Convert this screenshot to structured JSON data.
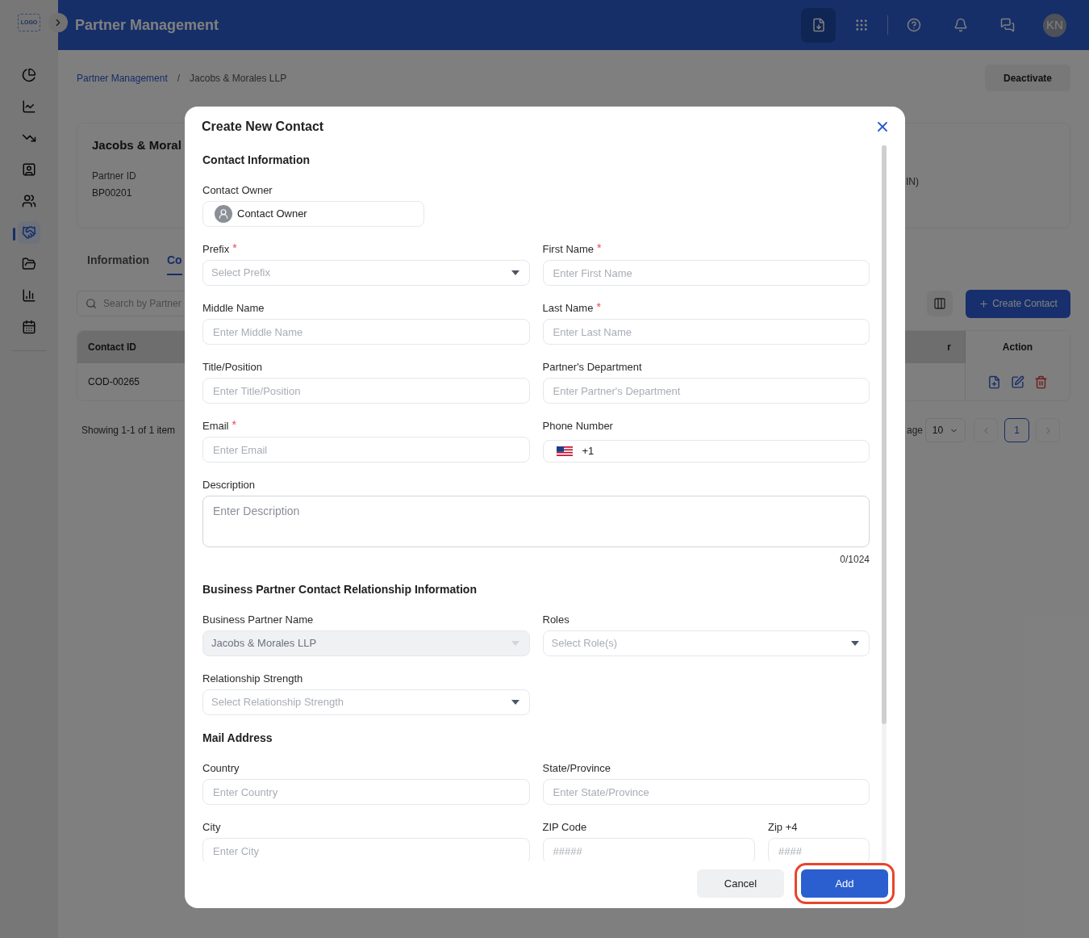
{
  "app": {
    "logo": "LOGO",
    "title": "Partner Management",
    "avatar": "KN"
  },
  "sidebar": {
    "items": [
      {
        "selected": false
      },
      {
        "selected": false
      },
      {
        "selected": false
      },
      {
        "selected": false
      },
      {
        "selected": false
      },
      {
        "selected": true
      },
      {
        "selected": false
      },
      {
        "selected": false
      },
      {
        "selected": false
      }
    ]
  },
  "breadcrumb": [
    "Partner Management",
    "Jacobs & Morales LLP"
  ],
  "breadcrumb_separator": "/",
  "deactivate_button": "Deactivate",
  "partner_card": {
    "name": "Jacobs & Moral",
    "id_label": "Partner ID",
    "id_value": "BP00201",
    "column_3": "IN)"
  },
  "tabs": [
    {
      "label": "Information",
      "selected": false
    },
    {
      "label": "Co",
      "selected": true
    }
  ],
  "search": {
    "placeholder": "Search by Partner"
  },
  "create_contact_button": "Create Contact",
  "table": {
    "columns": [
      "Contact ID",
      "r",
      "Action"
    ],
    "rows": [
      {
        "cells": [
          "COD-00265"
        ]
      }
    ]
  },
  "pagination": {
    "summary": "Showing 1-1 of 1 item",
    "per_page_label": "age",
    "per_page": "10",
    "pages": [
      {
        "label": "1",
        "selected": true
      }
    ]
  },
  "modal": {
    "title": "Create New Contact",
    "required_mark": "*",
    "sections": [
      {
        "title": "Contact Information",
        "rows": [
          [
            {
              "kind": "owner",
              "label": "Contact Owner",
              "required": false,
              "value": "Contact Owner"
            }
          ],
          [
            {
              "kind": "select",
              "label": "Prefix",
              "required": true,
              "placeholder": "Select Prefix",
              "disabled": false
            },
            {
              "kind": "input",
              "label": "First Name",
              "required": true,
              "placeholder": "Enter First Name"
            }
          ],
          [
            {
              "kind": "input",
              "label": "Middle Name",
              "required": false,
              "placeholder": "Enter Middle Name"
            },
            {
              "kind": "input",
              "label": "Last Name",
              "required": true,
              "placeholder": "Enter Last Name"
            }
          ],
          [
            {
              "kind": "input",
              "label": "Title/Position",
              "required": false,
              "placeholder": "Enter Title/Position"
            },
            {
              "kind": "input",
              "label": "Partner's Department",
              "required": false,
              "placeholder": "Enter Partner's Department"
            }
          ],
          [
            {
              "kind": "input",
              "label": "Email",
              "required": true,
              "placeholder": "Enter Email"
            },
            {
              "kind": "phone",
              "label": "Phone Number",
              "required": false,
              "value": "+1"
            }
          ],
          [
            {
              "kind": "textarea",
              "label": "Description",
              "required": false,
              "placeholder": "Enter Description",
              "counter": "0/1024"
            }
          ]
        ]
      },
      {
        "title": "Business Partner Contact Relationship Information",
        "rows": [
          [
            {
              "kind": "select",
              "label": "Business Partner Name",
              "required": false,
              "value": "Jacobs & Morales LLP",
              "disabled": true
            },
            {
              "kind": "select",
              "label": "Roles",
              "required": false,
              "placeholder": "Select Role(s)",
              "disabled": false
            }
          ],
          [
            {
              "kind": "select",
              "label": "Relationship Strength",
              "required": false,
              "placeholder": "Select Relationship Strength",
              "disabled": false
            }
          ]
        ]
      },
      {
        "title": "Mail Address",
        "rows": [
          [
            {
              "kind": "input",
              "label": "Country",
              "required": false,
              "placeholder": "Enter Country"
            },
            {
              "kind": "input",
              "label": "State/Province",
              "required": false,
              "placeholder": "Enter State/Province"
            }
          ],
          [
            {
              "kind": "input",
              "label": "City",
              "required": false,
              "placeholder": "Enter City"
            },
            {
              "kind": "input",
              "label": "ZIP Code",
              "required": false,
              "placeholder": "#####"
            },
            {
              "kind": "input",
              "label": "Zip +4",
              "required": false,
              "placeholder": "####"
            }
          ]
        ]
      }
    ],
    "buttons": [
      {
        "kind": "cancel",
        "label": "Cancel",
        "highlighted": false
      },
      {
        "kind": "primary",
        "label": "Add",
        "highlighted": true
      }
    ]
  }
}
